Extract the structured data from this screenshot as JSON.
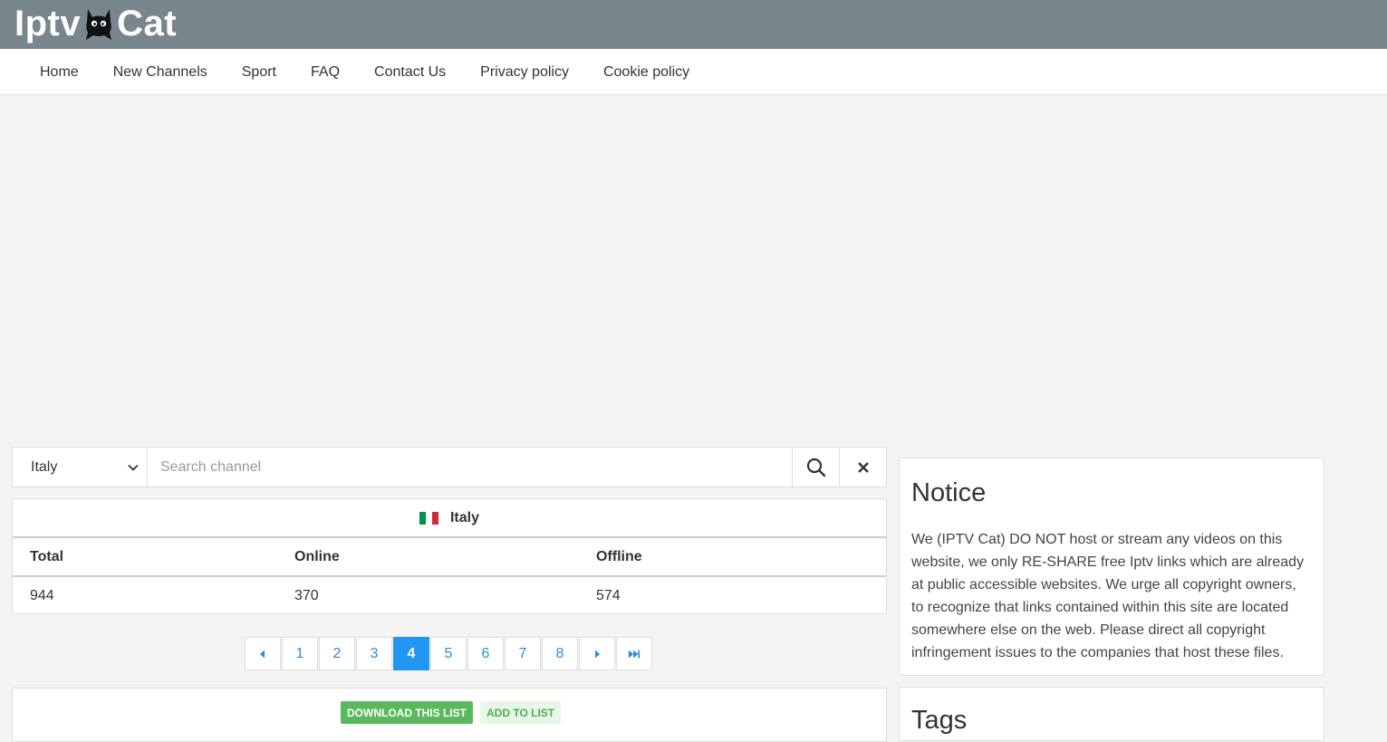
{
  "header": {
    "logo_left": "Iptv",
    "logo_right": "Cat"
  },
  "nav": {
    "items": [
      "Home",
      "New Channels",
      "Sport",
      "FAQ",
      "Contact Us",
      "Privacy policy",
      "Cookie policy"
    ]
  },
  "search": {
    "country_selected": "Italy",
    "placeholder": "Search channel",
    "value": ""
  },
  "stats": {
    "country": "Italy",
    "flag_colors": [
      "#009246",
      "#ffffff",
      "#ce2b37"
    ],
    "headers": [
      "Total",
      "Online",
      "Offline"
    ],
    "values": [
      "944",
      "370",
      "574"
    ]
  },
  "pagination": {
    "pages": [
      "1",
      "2",
      "3",
      "4",
      "5",
      "6",
      "7",
      "8"
    ],
    "active": "4"
  },
  "list_actions": {
    "download_label": "DOWNLOAD THIS LIST",
    "add_label": "ADD TO LIST"
  },
  "notice": {
    "title": "Notice",
    "body": "We (IPTV Cat) DO NOT host or stream any videos on this website, we only RE-SHARE free Iptv links which are already at public accessible websites. We urge all copyright owners, to recognize that links contained within this site are located somewhere else on the web. Please direct all copyright infringement issues to the companies that host these files."
  },
  "tags": {
    "title": "Tags"
  },
  "colors": {
    "topbar": "#78868e",
    "accent": "#2196f3",
    "success": "#5cb85c"
  }
}
